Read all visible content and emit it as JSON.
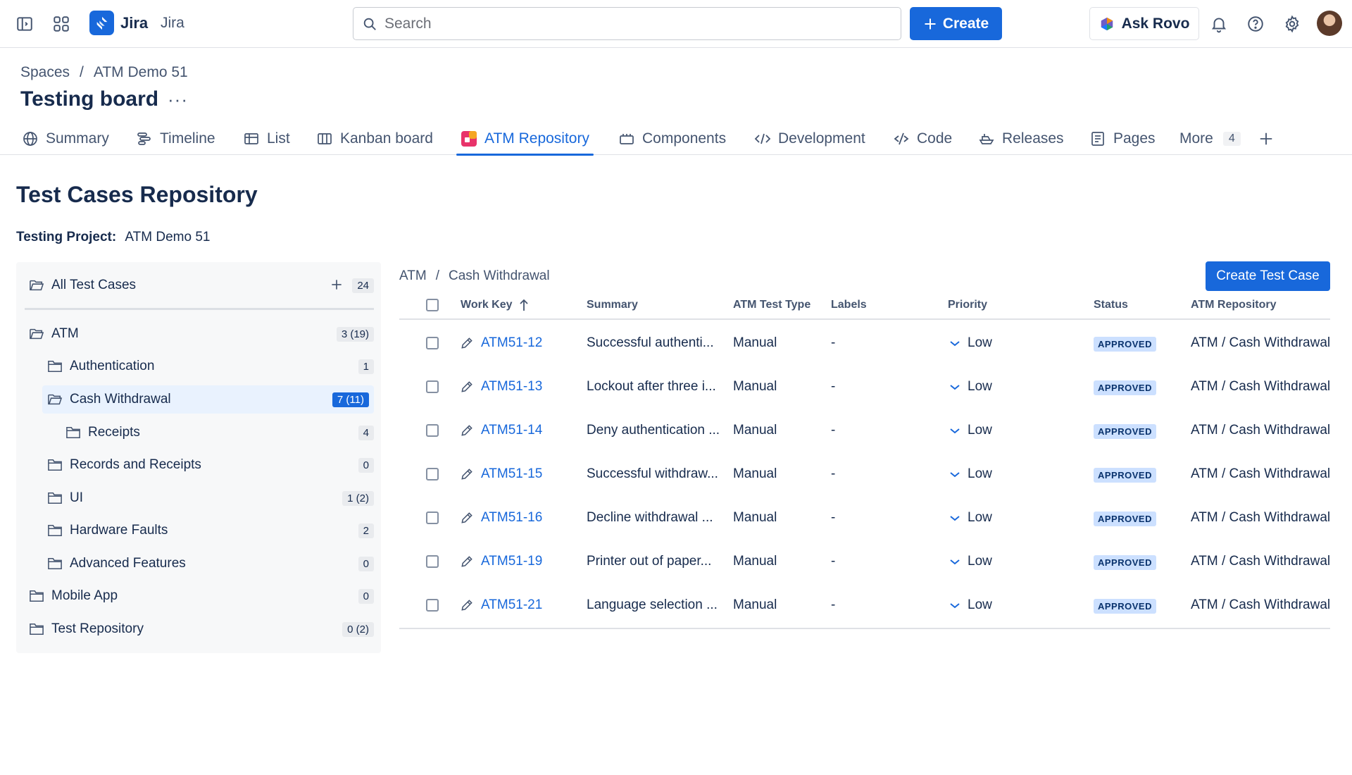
{
  "topbar": {
    "logo_text": "Jira",
    "app_name": "Jira",
    "search_placeholder": "Search",
    "create_label": "Create",
    "ask_rovo_label": "Ask Rovo"
  },
  "breadcrumb": {
    "items": [
      "Spaces",
      "/",
      "ATM Demo 51"
    ]
  },
  "page_title": "Testing board",
  "tabs": [
    {
      "label": "Summary",
      "icon": "globe-icon"
    },
    {
      "label": "Timeline",
      "icon": "timeline-icon"
    },
    {
      "label": "List",
      "icon": "list-icon"
    },
    {
      "label": "Kanban board",
      "icon": "board-icon"
    },
    {
      "label": "ATM Repository",
      "icon": "atm-app-icon",
      "active": true
    },
    {
      "label": "Components",
      "icon": "components-icon"
    },
    {
      "label": "Development",
      "icon": "code-brackets-icon"
    },
    {
      "label": "Code",
      "icon": "code-icon"
    },
    {
      "label": "Releases",
      "icon": "ship-icon"
    },
    {
      "label": "Pages",
      "icon": "page-icon"
    },
    {
      "label": "More",
      "badge": "4"
    }
  ],
  "repo": {
    "title": "Test Cases Repository",
    "project_label": "Testing Project:",
    "project_value": "ATM Demo 51"
  },
  "tree": {
    "all": {
      "label": "All Test Cases",
      "count": "24"
    },
    "items": [
      {
        "label": "ATM",
        "count": "3 (19)",
        "level": 0
      },
      {
        "label": "Authentication",
        "count": "1",
        "level": 1
      },
      {
        "label": "Cash Withdrawal",
        "count": "7 (11)",
        "level": 1,
        "selected": true
      },
      {
        "label": "Receipts",
        "count": "4",
        "level": 2
      },
      {
        "label": "Records and Receipts",
        "count": "0",
        "level": 1
      },
      {
        "label": "UI",
        "count": "1 (2)",
        "level": 1
      },
      {
        "label": "Hardware Faults",
        "count": "2",
        "level": 1
      },
      {
        "label": "Advanced Features",
        "count": "0",
        "level": 1
      },
      {
        "label": "Mobile App",
        "count": "0",
        "level": 0
      },
      {
        "label": "Test Repository",
        "count": "0 (2)",
        "level": 0
      }
    ]
  },
  "table": {
    "crumb": [
      "ATM",
      "/",
      "Cash Withdrawal"
    ],
    "create_label": "Create Test Case",
    "headers": {
      "work_key": "Work Key",
      "summary": "Summary",
      "type": "ATM Test Type",
      "labels": "Labels",
      "priority": "Priority",
      "status": "Status",
      "repo": "ATM Repository"
    },
    "rows": [
      {
        "key": "ATM51-12",
        "summary": "Successful authenti...",
        "type": "Manual",
        "labels": "-",
        "priority": "Low",
        "status": "APPROVED",
        "repo": "ATM / Cash Withdrawal"
      },
      {
        "key": "ATM51-13",
        "summary": "Lockout after three i...",
        "type": "Manual",
        "labels": "-",
        "priority": "Low",
        "status": "APPROVED",
        "repo": "ATM / Cash Withdrawal"
      },
      {
        "key": "ATM51-14",
        "summary": "Deny authentication ...",
        "type": "Manual",
        "labels": "-",
        "priority": "Low",
        "status": "APPROVED",
        "repo": "ATM / Cash Withdrawal"
      },
      {
        "key": "ATM51-15",
        "summary": "Successful withdraw...",
        "type": "Manual",
        "labels": "-",
        "priority": "Low",
        "status": "APPROVED",
        "repo": "ATM / Cash Withdrawal"
      },
      {
        "key": "ATM51-16",
        "summary": "Decline withdrawal ...",
        "type": "Manual",
        "labels": "-",
        "priority": "Low",
        "status": "APPROVED",
        "repo": "ATM / Cash Withdrawal"
      },
      {
        "key": "ATM51-19",
        "summary": "Printer out of paper...",
        "type": "Manual",
        "labels": "-",
        "priority": "Low",
        "status": "APPROVED",
        "repo": "ATM / Cash Withdrawal"
      },
      {
        "key": "ATM51-21",
        "summary": "Language selection ...",
        "type": "Manual",
        "labels": "-",
        "priority": "Low",
        "status": "APPROVED",
        "repo": "ATM / Cash Withdrawal"
      }
    ]
  },
  "colors": {
    "brand": "#1868db",
    "status_approved_bg": "#cce0ff",
    "selected_bg": "#e9f2fe"
  }
}
